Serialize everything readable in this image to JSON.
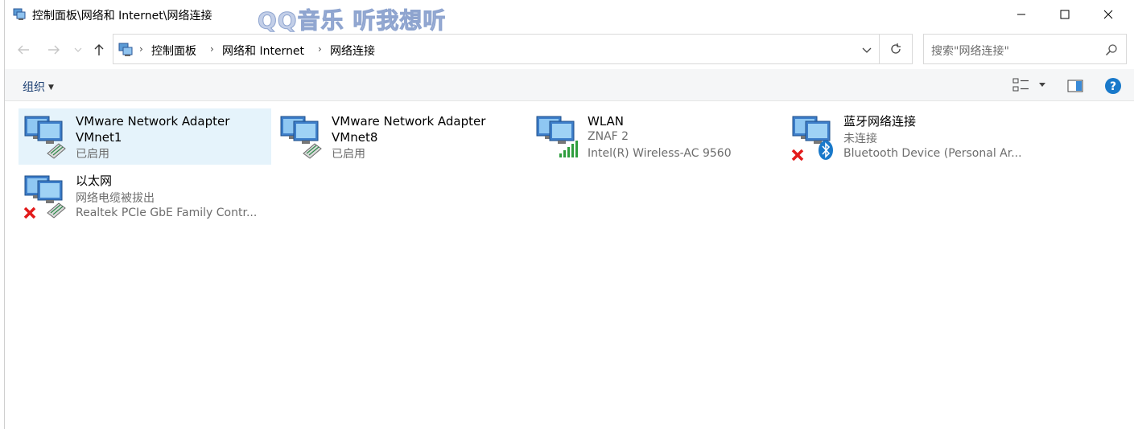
{
  "window": {
    "title": "控制面板\\网络和 Internet\\网络连接",
    "watermark": "QQ音乐 听我想听"
  },
  "address": {
    "crumbs": [
      "控制面板",
      "网络和 Internet",
      "网络连接"
    ]
  },
  "search": {
    "placeholder": "搜索\"网络连接\""
  },
  "toolbar": {
    "organize_label": "组织"
  },
  "connections": [
    {
      "name": "VMware Network Adapter VMnet1",
      "name_line1": "VMware Network Adapter",
      "name_line2": "VMnet1",
      "status": "已启用",
      "device": "",
      "icon": "vmware-adapter-icon",
      "selected": true
    },
    {
      "name": "VMware Network Adapter VMnet8",
      "name_line1": "VMware Network Adapter",
      "name_line2": "VMnet8",
      "status": "已启用",
      "device": "",
      "icon": "vmware-adapter-icon",
      "selected": false
    },
    {
      "name": "WLAN",
      "status": "ZNAF 2",
      "device": "Intel(R) Wireless-AC 9560",
      "icon": "wlan-icon",
      "selected": false
    },
    {
      "name": "蓝牙网络连接",
      "status": "未连接",
      "device": "Bluetooth Device (Personal Ar...",
      "icon": "bluetooth-network-icon",
      "selected": false
    },
    {
      "name": "以太网",
      "status": "网络电缆被拔出",
      "device": "Realtek PCIe GbE Family Contr...",
      "icon": "ethernet-icon",
      "selected": false
    }
  ],
  "colors": {
    "selection": "#e5f3fb",
    "link_blue": "#1a3e72",
    "help_blue": "#1979ca",
    "error_red": "#e21b1b",
    "signal_green": "#2e9e3d"
  }
}
